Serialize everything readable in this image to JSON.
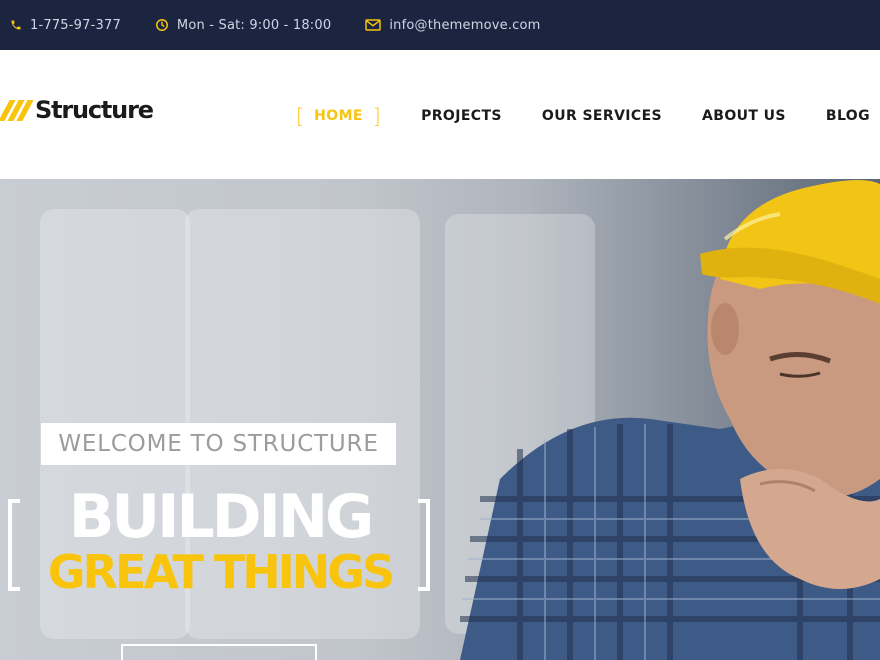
{
  "topbar": {
    "phone": "1-775-97-377",
    "hours": "Mon - Sat: 9:00 - 18:00",
    "email": "info@thememove.com"
  },
  "header": {
    "logo_text": "Structure",
    "nav": {
      "home": "HOME",
      "projects": "PROJECTS",
      "services": "OUR SERVICES",
      "about": "ABOUT US",
      "blog": "BLOG"
    }
  },
  "hero": {
    "welcome": "WELCOME TO STRUCTURE",
    "title_line1": "BUILDING",
    "title_line2": "GREAT THINGS"
  },
  "colors": {
    "accent": "#f8c40d",
    "topbar_bg": "#1b2540",
    "text_dark": "#1b1b1b"
  }
}
